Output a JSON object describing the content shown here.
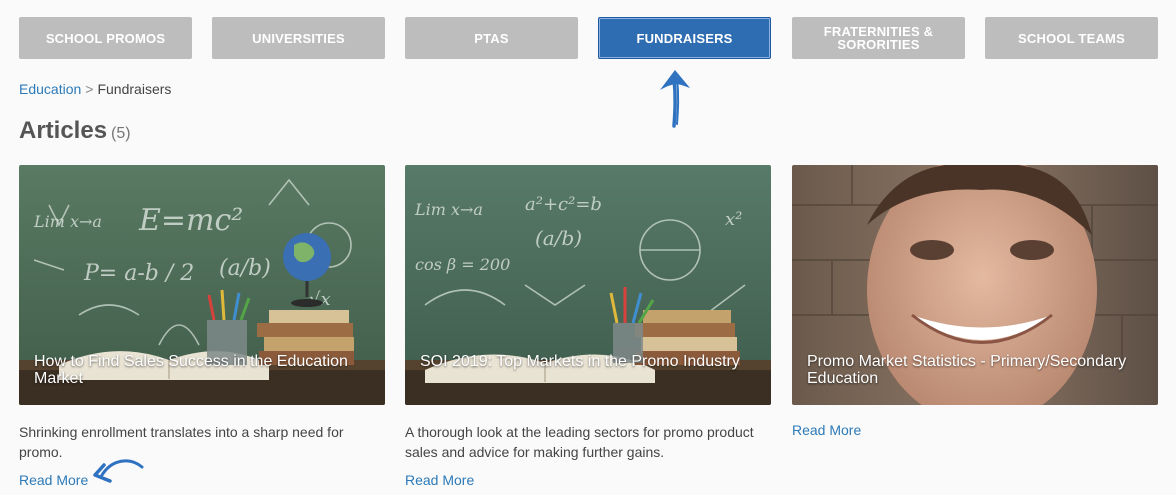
{
  "tabs": [
    {
      "label": "SCHOOL PROMOS",
      "active": false
    },
    {
      "label": "UNIVERSITIES",
      "active": false
    },
    {
      "label": "PTAS",
      "active": false
    },
    {
      "label": "FUNDRAISERS",
      "active": true
    },
    {
      "label_line1": "FRATERNITIES &",
      "label_line2": "SORORITIES",
      "active": false
    },
    {
      "label": "SCHOOL TEAMS",
      "active": false
    }
  ],
  "breadcrumb": {
    "parent": "Education",
    "separator": ">",
    "current": "Fundraisers"
  },
  "heading": {
    "title": "Articles",
    "count": "(5)"
  },
  "articles": [
    {
      "title": "How to Find Sales Success in the Education Market",
      "description": "Shrinking enrollment translates into a sharp need for promo.",
      "read_more": "Read More"
    },
    {
      "title": "SOI 2019: Top Markets in the Promo Industry",
      "description": "A thorough look at the leading sectors for promo product sales and advice for making further gains.",
      "read_more": "Read More"
    },
    {
      "title": "Promo Market Statistics - Primary/Secondary Education",
      "description": "",
      "read_more": "Read More"
    }
  ],
  "chalk": {
    "formula_1": "E=mc²",
    "formula_2": "P= a-b / 2",
    "formula_3": "Lim x→a",
    "formula_4": "√x",
    "formula_5": "a²+c²=b",
    "formula_6": "cos β = 200",
    "formula_7": "(a/b)",
    "formula_8": "x²"
  },
  "colors": {
    "tab_bg": "#bdbdbd",
    "tab_active": "#2f6db3",
    "link": "#2d7ab8",
    "annotation": "#2f72c0"
  }
}
